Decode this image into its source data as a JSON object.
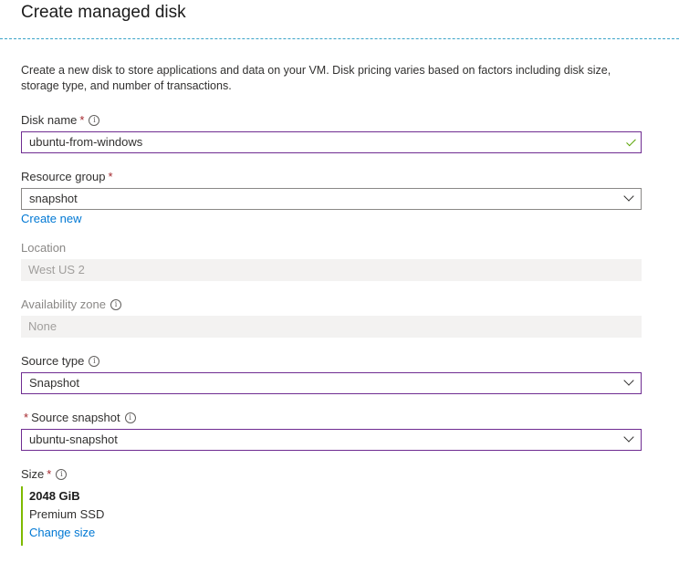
{
  "title": "Create managed disk",
  "description": "Create a new disk to store applications and data on your VM. Disk pricing varies based on factors including disk size, storage type, and number of transactions.",
  "disk_name": {
    "label": "Disk name",
    "required_mark": "*",
    "value": "ubuntu-from-windows",
    "valid": true
  },
  "resource_group": {
    "label": "Resource group",
    "required_mark": "*",
    "value": "snapshot",
    "create_new_link": "Create new"
  },
  "location": {
    "label": "Location",
    "value": "West US 2",
    "disabled": true
  },
  "availability_zone": {
    "label": "Availability zone",
    "value": "None",
    "disabled": true
  },
  "source_type": {
    "label": "Source type",
    "value": "Snapshot"
  },
  "source_snapshot": {
    "required_mark": "*",
    "label": "Source snapshot",
    "value": "ubuntu-snapshot"
  },
  "size": {
    "label": "Size",
    "required_mark": "*",
    "value": "2048 GiB",
    "tier": "Premium SSD",
    "change_link": "Change size"
  },
  "icons": {
    "info": "info-icon",
    "dropdown": "chevron-down-icon",
    "valid": "checkmark-icon"
  },
  "colors": {
    "accent": "#6f2c91",
    "link": "#0078d4",
    "valid": "#57a300",
    "size_bar": "#7fba00",
    "required": "#a4262c",
    "divider": "#3aa3c8"
  }
}
